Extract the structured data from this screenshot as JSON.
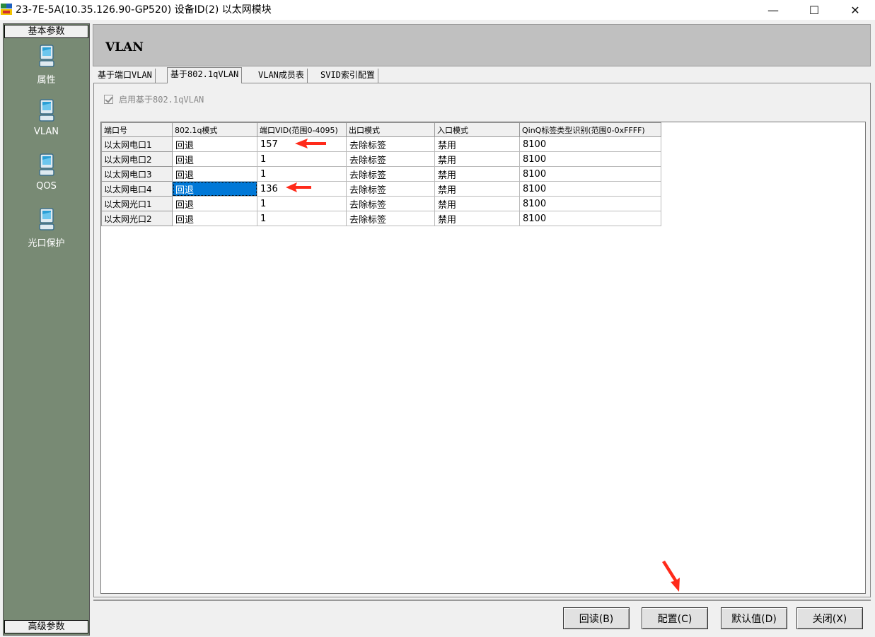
{
  "window": {
    "title": "23-7E-5A(10.35.126.90-GP520)  设备ID(2)  以太网模块",
    "minimize": "—",
    "maximize": "☐",
    "close": "✕"
  },
  "sidebar": {
    "header": "基本参数",
    "footer": "高级参数",
    "items": [
      {
        "label": "属性",
        "icon": "monitor-icon"
      },
      {
        "label": "VLAN",
        "icon": "monitor-icon"
      },
      {
        "label": "QOS",
        "icon": "monitor-icon"
      },
      {
        "label": "光口保护",
        "icon": "monitor-icon"
      }
    ],
    "bg_color": "#788a74"
  },
  "main": {
    "title": "VLAN",
    "tabs": [
      {
        "label": "基于端口VLAN",
        "active": false
      },
      {
        "label": "基于802.1qVLAN",
        "active": true
      },
      {
        "label": "VLAN成员表",
        "active": false
      },
      {
        "label": "SVID索引配置",
        "active": false
      }
    ],
    "enable_checkbox": {
      "label": "启用基于802.1qVLAN",
      "checked": true,
      "disabled": true
    },
    "table": {
      "headers": [
        "端口号",
        "802.1q模式",
        "端口VID(范围0-4095)",
        "出口模式",
        "入口模式",
        "QinQ标签类型识别(范围0-0xFFFF)"
      ],
      "rows": [
        [
          "以太网电口1",
          "回退",
          "157",
          "去除标签",
          "禁用",
          "8100"
        ],
        [
          "以太网电口2",
          "回退",
          "1",
          "去除标签",
          "禁用",
          "8100"
        ],
        [
          "以太网电口3",
          "回退",
          "1",
          "去除标签",
          "禁用",
          "8100"
        ],
        [
          "以太网电口4",
          "回退",
          "136",
          "去除标签",
          "禁用",
          "8100"
        ],
        [
          "以太网光口1",
          "回退",
          "1",
          "去除标签",
          "禁用",
          "8100"
        ],
        [
          "以太网光口2",
          "回退",
          "1",
          "去除标签",
          "禁用",
          "8100"
        ]
      ],
      "selected_row": 3
    },
    "buttons": {
      "read": "回读(B)",
      "config": "配置(C)",
      "default": "默认值(D)",
      "close": "关闭(X)"
    }
  },
  "annotation_color": "#ff2a1a",
  "selection_color": "#0078d7"
}
